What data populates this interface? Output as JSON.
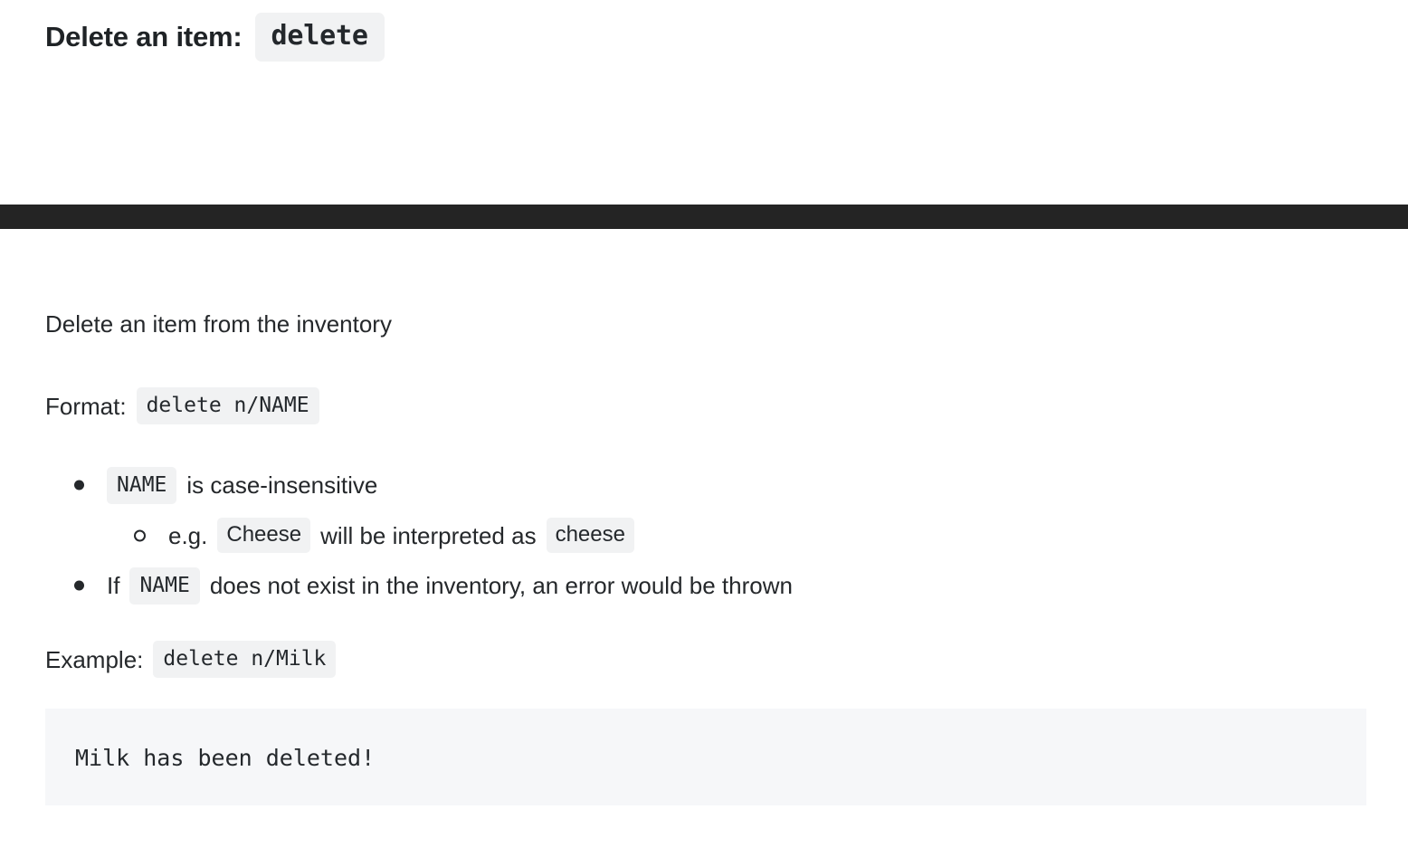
{
  "heading": {
    "text": "Delete an item:",
    "command": "delete"
  },
  "divider": {
    "color": "#242424"
  },
  "body": {
    "intro": "Delete an item from the inventory",
    "format": {
      "label": "Format:",
      "code": "delete n/NAME"
    },
    "bullets": [
      {
        "level": 1,
        "marker": "disc",
        "parts": [
          {
            "kind": "code",
            "text": "NAME"
          },
          {
            "kind": "text",
            "text": "is case-insensitive"
          }
        ]
      },
      {
        "level": 2,
        "marker": "circle",
        "parts": [
          {
            "kind": "text",
            "text": "e.g."
          },
          {
            "kind": "code-sans",
            "text": "Cheese"
          },
          {
            "kind": "text",
            "text": "will be interpreted as"
          },
          {
            "kind": "code-sans",
            "text": "cheese"
          }
        ]
      },
      {
        "level": 1,
        "marker": "disc",
        "parts": [
          {
            "kind": "text",
            "text": "If"
          },
          {
            "kind": "code",
            "text": "NAME"
          },
          {
            "kind": "text",
            "text": "does not exist in the inventory, an error would be thrown"
          }
        ]
      }
    ],
    "example": {
      "label": "Example:",
      "code": "delete n/Milk"
    },
    "output_block": {
      "text": "Milk has been deleted!",
      "background": "#f6f7f9"
    }
  },
  "colors": {
    "page_background": "#ffffff",
    "text": "#25282b",
    "chip_background": "#f1f2f3",
    "divider": "#242424",
    "code_block_background": "#f6f7f9"
  }
}
